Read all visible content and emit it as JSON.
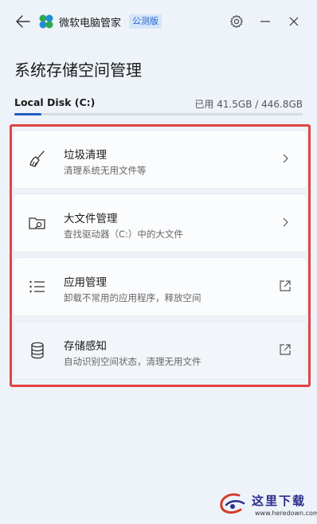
{
  "titlebar": {
    "app_name": "微软电脑管家",
    "badge": "公测版",
    "icons": [
      "back-arrow-icon",
      "app-logo-icon",
      "gear-icon",
      "minimize-icon",
      "close-icon"
    ]
  },
  "page": {
    "title": "系统存储空间管理"
  },
  "disk": {
    "name": "Local Disk (C:)",
    "usage": "已用 41.5GB / 446.8GB",
    "used_fraction": 0.093,
    "accent": "#1f5fbf"
  },
  "cards": [
    {
      "title": "垃圾清理",
      "subtitle": "清理系统无用文件等",
      "icon": "broom-icon",
      "action": "chevron-right-icon"
    },
    {
      "title": "大文件管理",
      "subtitle": "查找驱动器（C:）中的大文件",
      "icon": "folder-search-icon",
      "action": "chevron-right-icon"
    },
    {
      "title": "应用管理",
      "subtitle": "卸载不常用的应用程序，释放空间",
      "icon": "list-icon",
      "action": "external-link-icon"
    },
    {
      "title": "存储感知",
      "subtitle": "自动识别空间状态，清理无用文件",
      "icon": "database-icon",
      "action": "external-link-icon"
    }
  ],
  "highlight_color": "#e04444",
  "watermark": {
    "text": "这里下载",
    "url": "www.heredown.com"
  }
}
